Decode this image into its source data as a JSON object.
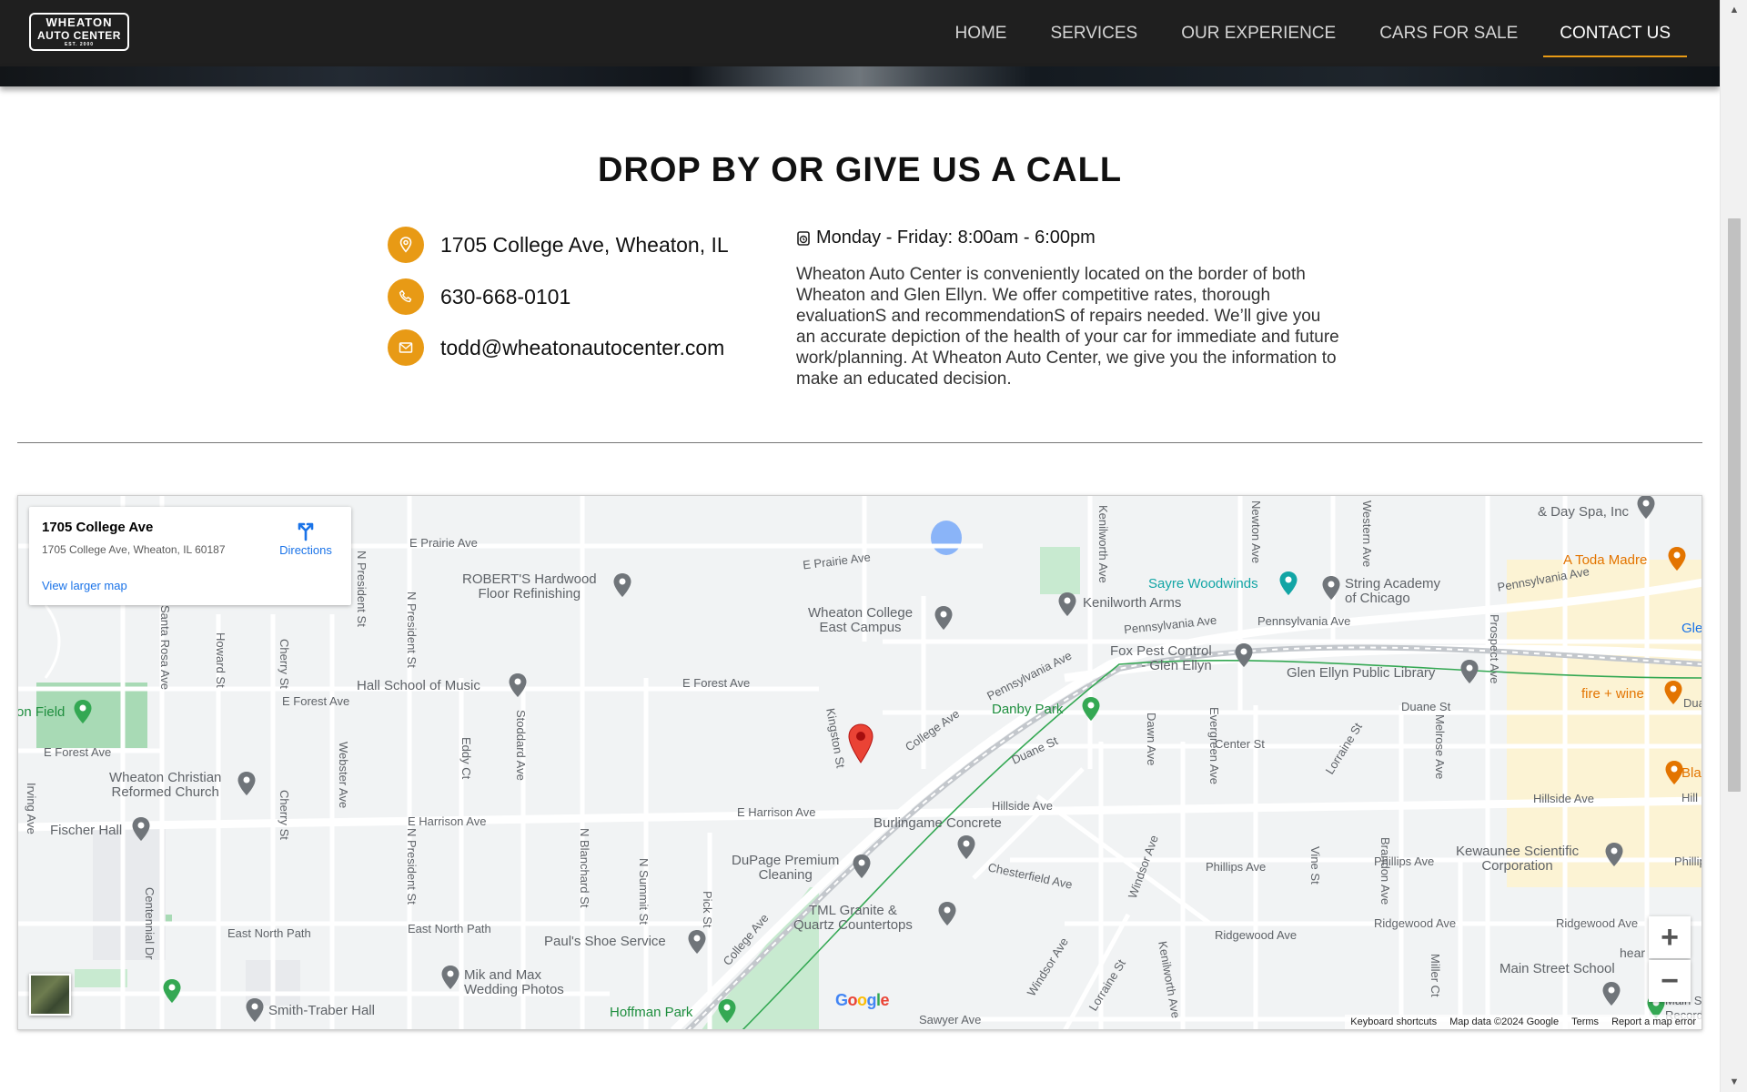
{
  "header": {
    "logo": {
      "line1": "WHEATON",
      "line2": "AUTO CENTER",
      "line3": "EST. 2000"
    },
    "nav": [
      {
        "label": "HOME"
      },
      {
        "label": "SERVICES"
      },
      {
        "label": "OUR EXPERIENCE"
      },
      {
        "label": "CARS FOR SALE"
      },
      {
        "label": "CONTACT US",
        "active": true
      }
    ],
    "accent_color": "#e89a15"
  },
  "section": {
    "title": "DROP BY OR GIVE US A CALL",
    "contacts": [
      {
        "icon": "location-pin-icon",
        "text": "1705 College Ave, Wheaton, IL"
      },
      {
        "icon": "phone-icon",
        "text": "630-668-0101"
      },
      {
        "icon": "email-icon",
        "text": "todd@wheatonautocenter.com"
      }
    ],
    "hours": "Monday - Friday: 8:00am - 6:00pm",
    "description": "Wheaton Auto Center is conveniently located on the border of both Wheaton and Glen Ellyn. We offer competitive rates, thorough evaluationS and recommendationS of repairs needed. We’ll give you an accurate depiction of the health of your car for immediate and future work/planning. At Wheaton Auto Center, we give you the information to make an educated decision."
  },
  "map": {
    "card": {
      "name": "1705 College Ave",
      "address": "1705 College Ave, Wheaton, IL 60187",
      "directions": "Directions",
      "larger_map": "View larger map"
    },
    "streets": [
      "E Prairie Ave",
      "E Prairie Ave",
      "E Forest Ave",
      "E Forest Ave",
      "E Forest Ave",
      "E Harrison Ave",
      "E Harrison Ave",
      "East North Path",
      "East North Path",
      "Hillside Ave",
      "Hillside Ave",
      "Pennsylvania Ave",
      "Pennsylvania Ave",
      "Pennsylvania Ave",
      "Pennsylvania Ave",
      "College Ave",
      "College Ave",
      "Duane St",
      "Duane St",
      "Center St",
      "Chesterfield Ave",
      "Phillips Ave",
      "Phillips Ave",
      "Ridgewood Ave",
      "Ridgewood Ave",
      "Ridgewood Ave",
      "Sawyer Ave",
      "N President St",
      "N President St",
      "N President St",
      "Howard St",
      "Cherry St",
      "Cherry St",
      "Webster Ave",
      "Santa Rosa Ave",
      "Irving Ave",
      "Eddy Ct",
      "Stoddard Ave",
      "N Blanchard St",
      "N Summit St",
      "Pick St",
      "Kingston St",
      "Kenilworth Ave",
      "Kenilworth Ave",
      "Newton Ave",
      "Western Ave",
      "Prospect Ave",
      "Dawn Ave",
      "Evergreen Ave",
      "Lorraine St",
      "Lorraine St",
      "Melrose Ave",
      "Windsor Ave",
      "Windsor Ave",
      "Vine St",
      "Brandon Ave",
      "Miller Ct",
      "Centennial Dr"
    ],
    "pois": [
      {
        "name": "ROBERT'S Hardwood\nFloor Refinishing"
      },
      {
        "name": "Wheaton College\nEast Campus"
      },
      {
        "name": "Sayre Woodwinds"
      },
      {
        "name": "String Academy\nof Chicago"
      },
      {
        "name": "Kenilworth Arms"
      },
      {
        "name": "& Day Spa, Inc"
      },
      {
        "name": "A Toda Madre"
      },
      {
        "name": "Fox Pest Control\n- Glen Ellyn"
      },
      {
        "name": "Glen Ellyn Public Library"
      },
      {
        "name": "fire + wine"
      },
      {
        "name": "Danby Park"
      },
      {
        "name": "Hall School of Music"
      },
      {
        "name": "on Field"
      },
      {
        "name": "Wheaton Christian\nReformed Church"
      },
      {
        "name": "Fischer Hall"
      },
      {
        "name": "Burlingame Concrete"
      },
      {
        "name": "DuPage Premium\nCleaning"
      },
      {
        "name": "TML Granite &\nQuartz Countertops"
      },
      {
        "name": "Paul's Shoe Service"
      },
      {
        "name": "Mik and Max\nWedding Photos"
      },
      {
        "name": "Smith-Traber Hall"
      },
      {
        "name": "Hoffman Park"
      },
      {
        "name": "Kewaunee Scientific\nCorporation"
      },
      {
        "name": "Main Street School"
      },
      {
        "name": "Gle"
      },
      {
        "name": "Blac"
      },
      {
        "name": "Hill"
      },
      {
        "name": "Phillip"
      },
      {
        "name": "hear"
      },
      {
        "name": "Dua"
      },
      {
        "name": "Main St\nRecord"
      }
    ],
    "logo": "Google",
    "attribution": [
      "Keyboard shortcuts",
      "Map data ©2024 Google",
      "Terms",
      "Report a map error"
    ],
    "zoom_in": "+",
    "zoom_out": "−"
  }
}
